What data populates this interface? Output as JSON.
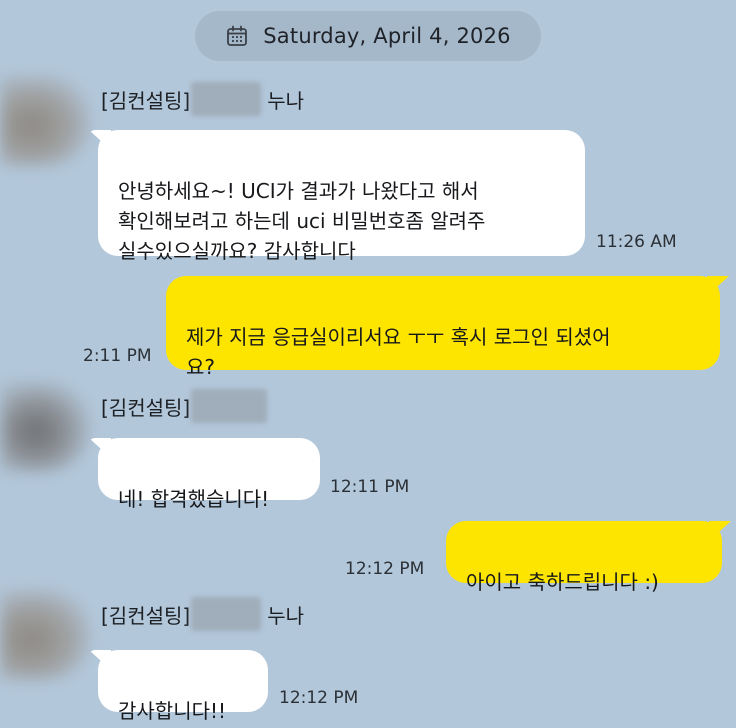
{
  "date_divider": {
    "icon": "calendar-icon",
    "label": "Saturday, April 4, 2026"
  },
  "colors": {
    "background": "#b2c7da",
    "incoming_bubble": "#ffffff",
    "outgoing_bubble": "#fee500"
  },
  "messages": [
    {
      "sender": {
        "prefix": "[김컨설팅]",
        "suffix": "누나"
      },
      "text": "안녕하세요~! UCI가 결과가 나왔다고 해서\n확인해보려고 하는데 uci 비밀번호좀 알려주\n실수있으실까요? 감사합니다",
      "time": "11:26 AM"
    },
    {
      "text": "제가 지금 응급실이리서요 ㅜㅜ 혹시 로그인 되셨어\n요?",
      "time": "2:11 PM"
    },
    {
      "sender": {
        "prefix": "[김컨설팅]",
        "suffix": ""
      },
      "text": "네! 합격했습니다!",
      "time": "12:11 PM"
    },
    {
      "text": "아이고 축하드립니다 :)",
      "time": "12:12 PM"
    },
    {
      "sender": {
        "prefix": "[김컨설팅]",
        "suffix": "누나"
      },
      "text": "감사합니다!!",
      "time": "12:12 PM"
    }
  ]
}
